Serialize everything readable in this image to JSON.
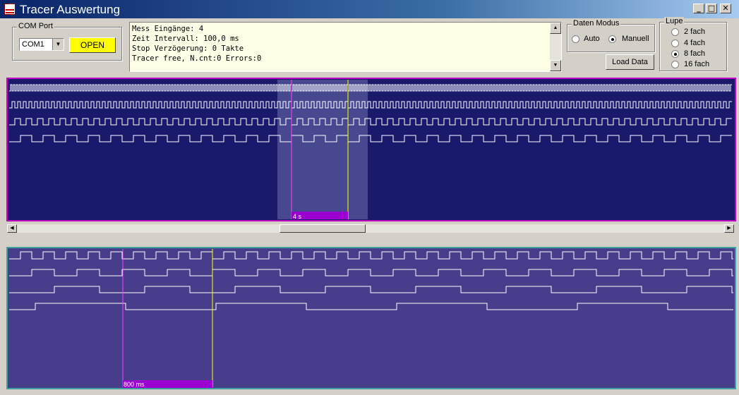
{
  "window": {
    "title": "Tracer Auswertung"
  },
  "com_port": {
    "group_label": "COM Port",
    "selected": "COM1",
    "open_label": "OPEN"
  },
  "messages": [
    "Mess Eingänge: 4",
    "Zeit Intervall: 100,0 ms",
    "Stop Verzögerung: 0 Takte",
    "Tracer free, N.cnt:0 Errors:0"
  ],
  "daten_modus": {
    "group_label": "Daten Modus",
    "options": [
      "Auto",
      "Manuell"
    ],
    "selected": "Manuell",
    "load_label": "Load Data"
  },
  "lupe": {
    "group_label": "Lupe",
    "options": [
      "2 fach",
      "4 fach",
      "8 fach",
      "16 fach"
    ],
    "selected": "8 fach"
  },
  "overview": {
    "marker_label": "4 s",
    "channels": 4,
    "scroll_fraction": 0.375
  },
  "zoom": {
    "marker_label": "800 ms",
    "channels": 4
  },
  "colors": {
    "overview_bg": "#1a1a6c",
    "overview_border": "#c000c0",
    "zoom_bg": "#483d8b",
    "zoom_border": "#40a0a0",
    "signal": "#ffffff",
    "cursor_a": "#ff40ff",
    "cursor_b": "#ffff00",
    "marker_bar": "#9c00d0"
  }
}
